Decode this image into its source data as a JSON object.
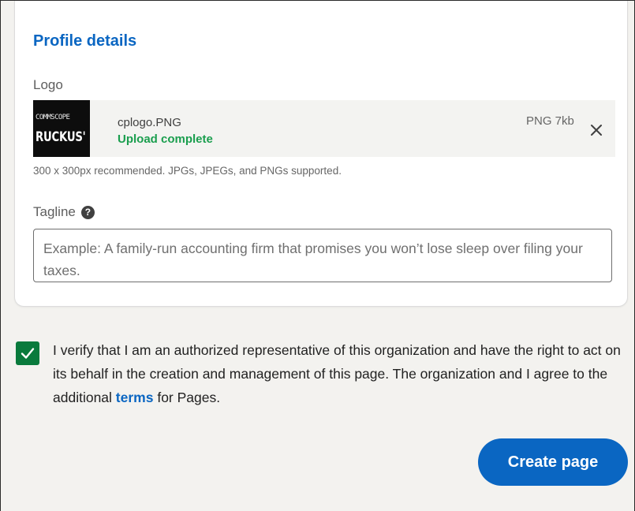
{
  "profile": {
    "title": "Profile details",
    "logo_label": "Logo",
    "file": {
      "thumb_top_text": "COMMSCOPE",
      "thumb_main_text": "RUCKUS'",
      "name": "cplogo.PNG",
      "status": "Upload complete",
      "meta": "PNG 7kb",
      "close_icon": "close-icon"
    },
    "logo_hint": "300 x 300px recommended. JPGs, JPEGs, and PNGs supported.",
    "tagline_label": "Tagline",
    "tagline_help_glyph": "?",
    "tagline_placeholder": "Example: A family-run accounting firm that promises you won’t lose sleep over filing your taxes."
  },
  "verify": {
    "checked": true,
    "text_before": "I verify that I am an authorized representative of this organization and have the right to act on its behalf in the creation and management of this page. The organization and I agree to the additional ",
    "link_text": "terms",
    "text_after": " for Pages."
  },
  "actions": {
    "create_label": "Create page"
  },
  "colors": {
    "accent": "#0a66c2",
    "success": "#1a9e4e",
    "checkbox": "#097a3c"
  }
}
